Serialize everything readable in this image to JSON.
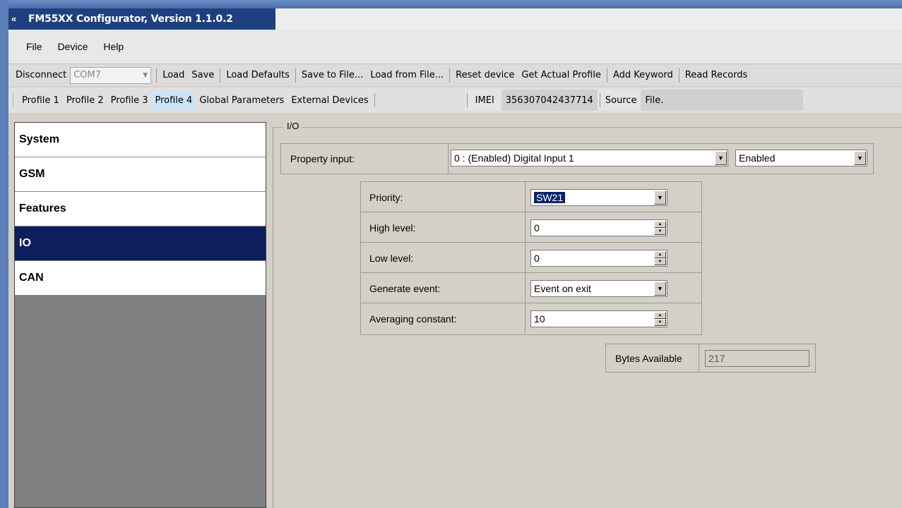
{
  "window": {
    "title": "FM55XX Configurator, Version 1.1.0.2",
    "icon": "app-logo-icon"
  },
  "menu": {
    "items": [
      "File",
      "Device",
      "Help"
    ]
  },
  "toolbar": {
    "disconnect": "Disconnect",
    "com_port": "COM7",
    "load": "Load",
    "save": "Save",
    "load_defaults": "Load Defaults",
    "save_to_file": "Save to File...",
    "load_from_file": "Load from File...",
    "reset_device": "Reset device",
    "get_actual_profile": "Get Actual Profile",
    "add_keyword": "Add Keyword",
    "read_records": "Read Records"
  },
  "profiles": {
    "tabs": [
      "Profile 1",
      "Profile 2",
      "Profile 3",
      "Profile 4",
      "Global Parameters",
      "External Devices"
    ],
    "active_index": 3,
    "imei_label": "IMEI",
    "imei_value": "356307042437714",
    "source_label": "Source",
    "source_value": "File."
  },
  "sidebar": {
    "items": [
      "System",
      "GSM",
      "Features",
      "IO",
      "CAN"
    ],
    "active": "IO"
  },
  "io": {
    "group_title": "I/O",
    "property_input_label": "Property input:",
    "property_input_value": "0 : (Enabled) Digital Input 1",
    "enabled_value": "Enabled",
    "params": {
      "priority_label": "Priority:",
      "priority_value": "SW21",
      "high_level_label": "High level:",
      "high_level_value": "0",
      "low_level_label": "Low level:",
      "low_level_value": "0",
      "generate_event_label": "Generate event:",
      "generate_event_value": "Event on exit",
      "averaging_label": "Averaging constant:",
      "averaging_value": "10"
    },
    "bytes_label": "Bytes Available",
    "bytes_value": "217"
  },
  "colors": {
    "title_bar": "#1e3f80",
    "selected_nav": "#0d1f5c",
    "active_profile_tab": "#cce4f7",
    "selection_highlight": "#0a246a"
  }
}
